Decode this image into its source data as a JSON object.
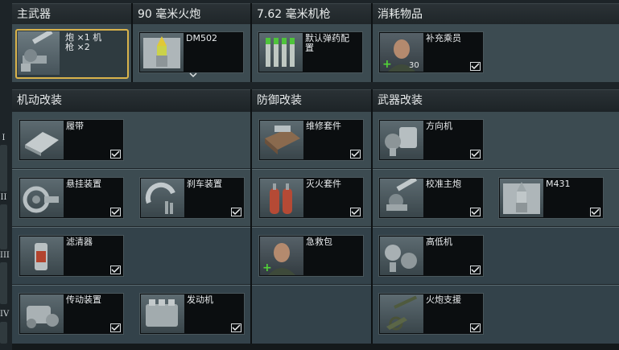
{
  "headers": {
    "main_weapon": "主武器",
    "gun": "90 毫米火炮",
    "mg": "7.62 毫米机枪",
    "consumables": "消耗物品",
    "mobility": "机动改装",
    "protection": "防御改装",
    "firepower": "武器改装"
  },
  "tiers": [
    "I",
    "II",
    "III",
    "IV"
  ],
  "top_slots": {
    "main_weapon": {
      "label": "炮 ×1 机\n枪 ×2",
      "icon": "cannon-icon"
    },
    "gun_ammo": {
      "label": "DM502",
      "icon": "shell-icon"
    },
    "mg_ammo": {
      "label": "默认弹药配\n置",
      "icon": "mg-ammo-icon"
    },
    "crew": {
      "label": "补充乘员",
      "count": "30",
      "icon": "crew-portrait-icon"
    }
  },
  "mobility": [
    {
      "label": "履带",
      "icon": "track-icon"
    },
    {
      "label": "悬挂装置",
      "icon": "suspension-icon"
    },
    {
      "label": "刹车装置",
      "icon": "brake-icon"
    },
    {
      "label": "滤清器",
      "icon": "filter-icon"
    },
    {
      "label": "传动装置",
      "icon": "transmission-icon"
    },
    {
      "label": "发动机",
      "icon": "engine-icon"
    }
  ],
  "protection": [
    {
      "label": "维修套件",
      "icon": "repair-kit-icon"
    },
    {
      "label": "灭火套件",
      "icon": "extinguisher-icon"
    },
    {
      "label": "急救包",
      "icon": "medkit-crew-icon"
    }
  ],
  "firepower": [
    {
      "label": "方向机",
      "icon": "horizontal-drive-icon"
    },
    {
      "label": "校准主炮",
      "icon": "adjustment-icon"
    },
    {
      "label": "M431",
      "icon": "heat-shell-icon"
    },
    {
      "label": "高低机",
      "icon": "elevation-drive-icon"
    },
    {
      "label": "火炮支援",
      "icon": "artillery-icon"
    }
  ],
  "colors": {
    "accent": "#d9b34b",
    "plus": "#52d338",
    "background": "#1d2428"
  }
}
